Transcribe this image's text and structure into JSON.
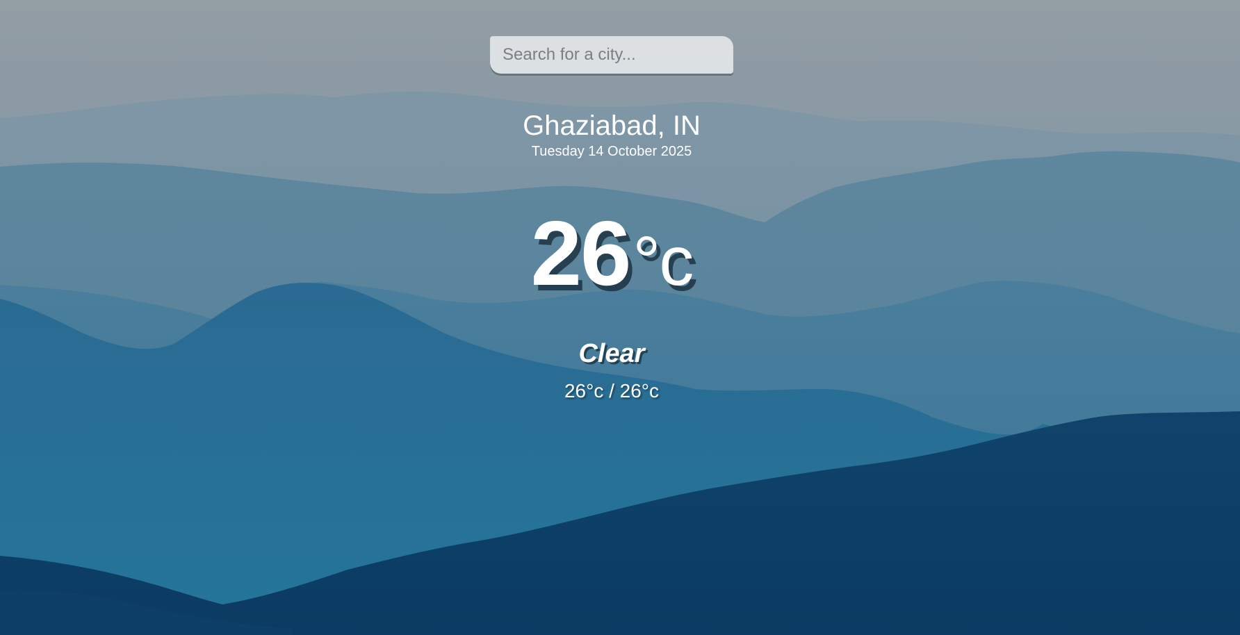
{
  "search": {
    "placeholder": "Search for a city...",
    "value": ""
  },
  "location": {
    "city": "Ghaziabad, IN",
    "date": "Tuesday 14 October 2025"
  },
  "current": {
    "temperature": "26",
    "unit": "°c"
  },
  "weather": {
    "condition": "Clear",
    "hi_low": "26°c / 26°c"
  },
  "background": {
    "description_icon": "mountain-landscape-background",
    "colors": {
      "sky": "#8e9aa2",
      "far_hills": "#6f8ea0",
      "mid_hills": "#3f7a9a",
      "near_hills": "#1f5f86",
      "foreground": "#0b3c63"
    }
  }
}
